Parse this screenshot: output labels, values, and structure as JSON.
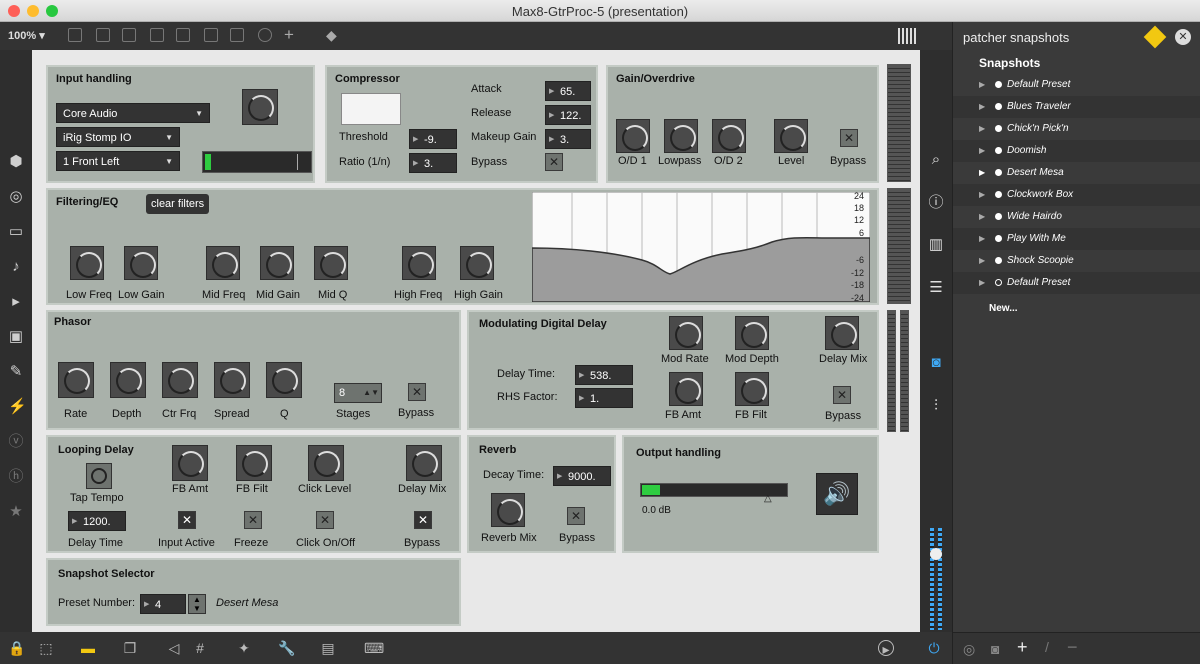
{
  "window": {
    "title": "Max8-GtrProc-5 (presentation)"
  },
  "toolbar": {
    "zoom": "100%"
  },
  "snapshots": {
    "header": "patcher snapshots",
    "section": "Snapshots",
    "new_label": "New...",
    "items": [
      "Default Preset",
      "Blues Traveler",
      "Chick'n Pick'n",
      "Doomish",
      "Desert Mesa",
      "Clockwork Box",
      "Wide Hairdo",
      "Play With Me",
      "Shock Scoopie",
      "Default Preset"
    ]
  },
  "input": {
    "title": "Input handling",
    "driver": "Core Audio",
    "device": "iRig Stomp IO",
    "channel": "1 Front Left"
  },
  "compressor": {
    "title": "Compressor",
    "threshold_label": "Threshold",
    "threshold": "-9.",
    "ratio_label": "Ratio (1/n)",
    "ratio": "3.",
    "attack_label": "Attack",
    "attack": "65.",
    "release_label": "Release",
    "release": "122.",
    "makeup_label": "Makeup Gain",
    "makeup": "3.",
    "bypass_label": "Bypass"
  },
  "gain": {
    "title": "Gain/Overdrive",
    "knobs": [
      "O/D 1",
      "Lowpass",
      "O/D 2",
      "Level"
    ],
    "bypass_label": "Bypass"
  },
  "filter": {
    "title": "Filtering/EQ",
    "clear_label": "clear filters",
    "knobs": [
      "Low Freq",
      "Low Gain",
      "Mid Freq",
      "Mid Gain",
      "Mid Q",
      "High Freq",
      "High Gain"
    ],
    "scale": [
      "24",
      "18",
      "12",
      "6",
      "-6",
      "-12",
      "-18",
      "-24"
    ]
  },
  "phasor": {
    "title": "Phasor",
    "knobs": [
      "Rate",
      "Depth",
      "Ctr Frq",
      "Spread",
      "Q"
    ],
    "stages_label": "Stages",
    "stages": "8",
    "bypass_label": "Bypass"
  },
  "moddelay": {
    "title": "Modulating Digital Delay",
    "delay_label": "Delay Time:",
    "delay": "538.",
    "rhs_label": "RHS Factor:",
    "rhs": "1.",
    "knobs": [
      "Mod Rate",
      "Mod Depth",
      "Delay Mix",
      "FB Amt",
      "FB Filt"
    ],
    "bypass_label": "Bypass"
  },
  "looping": {
    "title": "Looping Delay",
    "tap_label": "Tap Tempo",
    "fbamt_label": "FB Amt",
    "fbfilt_label": "FB Filt",
    "click_level_label": "Click Level",
    "mix_label": "Delay Mix",
    "delay": "1200.",
    "delay_label": "Delay Time",
    "input_active_label": "Input Active",
    "freeze_label": "Freeze",
    "click_onoff_label": "Click On/Off",
    "bypass_label": "Bypass"
  },
  "reverb": {
    "title": "Reverb",
    "decay_label": "Decay Time:",
    "decay": "9000.",
    "mix_label": "Reverb Mix",
    "bypass_label": "Bypass"
  },
  "output": {
    "title": "Output handling",
    "level": "0.0 dB"
  },
  "selector": {
    "title": "Snapshot Selector",
    "preset_label": "Preset Number:",
    "preset": "4",
    "preset_name": "Desert Mesa"
  },
  "colors": {
    "panel": "#a9b1aa",
    "meter_green": "#2ecc40"
  }
}
